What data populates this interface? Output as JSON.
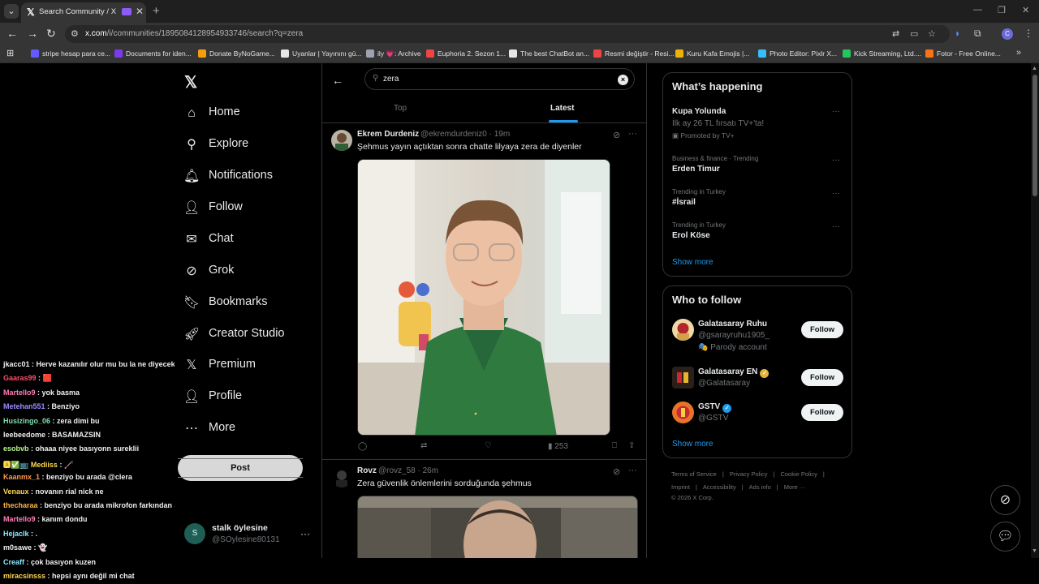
{
  "browser": {
    "tab_title": "Search Community / X",
    "url_host": "x.com",
    "url_path": "/i/communities/1895084128954933746/search?q=zera",
    "bookmarks": [
      {
        "label": "stripe hesap para ce...",
        "color": "#635bff"
      },
      {
        "label": "Documents for iden...",
        "color": "#7c3aed"
      },
      {
        "label": "Donate ByNoGame...",
        "color": "#f59e0b"
      },
      {
        "label": "Uyanlar | Yayınını gü...",
        "color": "#e5e7eb"
      },
      {
        "label": "ily 💗: Archive",
        "color": "#9ca3af"
      },
      {
        "label": "Euphoria 2. Sezon 1...",
        "color": "#ef4444"
      },
      {
        "label": "The best ChatBot an...",
        "color": "#e5e7eb"
      },
      {
        "label": "Resmi değiştir - Resi...",
        "color": "#ef4444"
      },
      {
        "label": "Kuru Kafa Emojis |...",
        "color": "#eab308"
      },
      {
        "label": "Photo Editor: Pixlr X...",
        "color": "#38bdf8"
      },
      {
        "label": "Kick Streaming, Ltd....",
        "color": "#22c55e"
      },
      {
        "label": "Fotor - Free Online...",
        "color": "#f97316"
      }
    ]
  },
  "chat": [
    {
      "user": "jkacc01",
      "msg": "Herve kazanılır olur mu bu la ne diyecek",
      "color": "#efeff1"
    },
    {
      "user": "Gaaras99",
      "msg": "🟥",
      "color": "#ff4d6d"
    },
    {
      "user": "Martello9",
      "msg": "yok basma",
      "color": "#ff7eb6"
    },
    {
      "user": "Metehan551",
      "msg": "Benziyo",
      "color": "#9b8cff"
    },
    {
      "user": "Husizingo_06",
      "msg": "zera dimi bu",
      "color": "#7ee0b0"
    },
    {
      "user": "leebeedome",
      "msg": "BASAMAZSIN",
      "color": "#efeff1"
    },
    {
      "user": "esobvb",
      "msg": "ohaaa niyee basıyonn sureklii",
      "color": "#b8f28c"
    },
    {
      "user": "🅰✅📺 Mediiss",
      "msg": "🦯",
      "color": "#ffd84d"
    },
    {
      "user": "Kaanmx_1",
      "msg": "benziyo bu arada @clera",
      "color": "#ff9b4d"
    },
    {
      "user": "Venaux",
      "msg": "novanın rial nick ne",
      "color": "#ffd84d"
    },
    {
      "user": "thecharaa",
      "msg": "benziyo bu arada mikrofon farkından anlıyom kim oldugunu",
      "color": "#ffb347"
    },
    {
      "user": "Martello9",
      "msg": "kanım dondu",
      "color": "#ff7eb6"
    },
    {
      "user": "Hejaclk",
      "msg": ".",
      "color": "#8be9fd"
    },
    {
      "user": "m0sawe",
      "msg": "👻",
      "color": "#efeff1"
    },
    {
      "user": "Creaff",
      "msg": "çok basıyon kuzen",
      "color": "#8be9fd"
    },
    {
      "user": "miracsinsss",
      "msg": "hepsi aynı değil mi chat",
      "color": "#ffd84d"
    }
  ],
  "sidebar": {
    "items": [
      {
        "label": "Home",
        "icon": "home-icon",
        "glyph": "⌂"
      },
      {
        "label": "Explore",
        "icon": "search-icon",
        "glyph": "⚲"
      },
      {
        "label": "Notifications",
        "icon": "bell-icon",
        "glyph": "🔔︎"
      },
      {
        "label": "Follow",
        "icon": "person-add-icon",
        "glyph": "👤︎"
      },
      {
        "label": "Chat",
        "icon": "mail-icon",
        "glyph": "✉"
      },
      {
        "label": "Grok",
        "icon": "grok-icon",
        "glyph": "⊘"
      },
      {
        "label": "Bookmarks",
        "icon": "bookmark-icon",
        "glyph": "🔖︎"
      },
      {
        "label": "Creator Studio",
        "icon": "rocket-icon",
        "glyph": "🚀︎"
      },
      {
        "label": "Premium",
        "icon": "x-logo-icon",
        "glyph": "𝕏"
      },
      {
        "label": "Profile",
        "icon": "person-icon",
        "glyph": "👤︎"
      },
      {
        "label": "More",
        "icon": "more-circle-icon",
        "glyph": "⋯"
      }
    ],
    "post_label": "Post",
    "account": {
      "initial": "S",
      "name": "stalk öylesine",
      "handle": "@SOylesine80131"
    }
  },
  "search": {
    "query": "zera",
    "tabs": [
      "Top",
      "Latest"
    ],
    "active_tab": "Latest"
  },
  "tweets": [
    {
      "name": "Ekrem Durdeniz",
      "handle": "@ekremdurdeniz0",
      "time": "· 19m",
      "text": "Şehmus yayın açtıktan sonra chatte lilyaya zera de diyenler",
      "views": "253"
    },
    {
      "name": "Rovz",
      "handle": "@rovz_58",
      "time": "· 26m",
      "text": "Zera güvenlik önlemlerini sorduğunda şehmus"
    }
  ],
  "trends": {
    "title": "What’s happening",
    "items": [
      {
        "name": "Kupa Yolunda",
        "sub": "İlk ay 26 TL fırsatı TV+'ta!",
        "promo": "Promoted by TV+"
      },
      {
        "context": "Business & finance · Trending",
        "name": "Erden Timur"
      },
      {
        "context": "Trending in Turkey",
        "name": "#İsrail"
      },
      {
        "context": "Trending in Turkey",
        "name": "Erol Köse"
      }
    ],
    "show_more": "Show more"
  },
  "who_to_follow": {
    "title": "Who to follow",
    "accounts": [
      {
        "name": "Galatasaray Ruhu",
        "handle": "@gsarayruhu1905_",
        "label": "🎭 Parody account",
        "button": "Follow"
      },
      {
        "name": "Galatasaray EN",
        "handle": "@Galatasaray",
        "verified_color": "#e3b341",
        "button": "Follow"
      },
      {
        "name": "GSTV",
        "handle": "@GSTV",
        "verified_color": "#1d9bf0",
        "button": "Follow"
      }
    ],
    "show_more": "Show more"
  },
  "footer": {
    "line1": [
      "Terms of Service",
      "|",
      "Privacy Policy",
      "|",
      "Cookie Policy",
      "|"
    ],
    "line2": [
      "Imprint",
      "|",
      "Accessibility",
      "|",
      "Ads info",
      "|",
      "More ···"
    ],
    "copyright": "© 2026 X Corp."
  }
}
